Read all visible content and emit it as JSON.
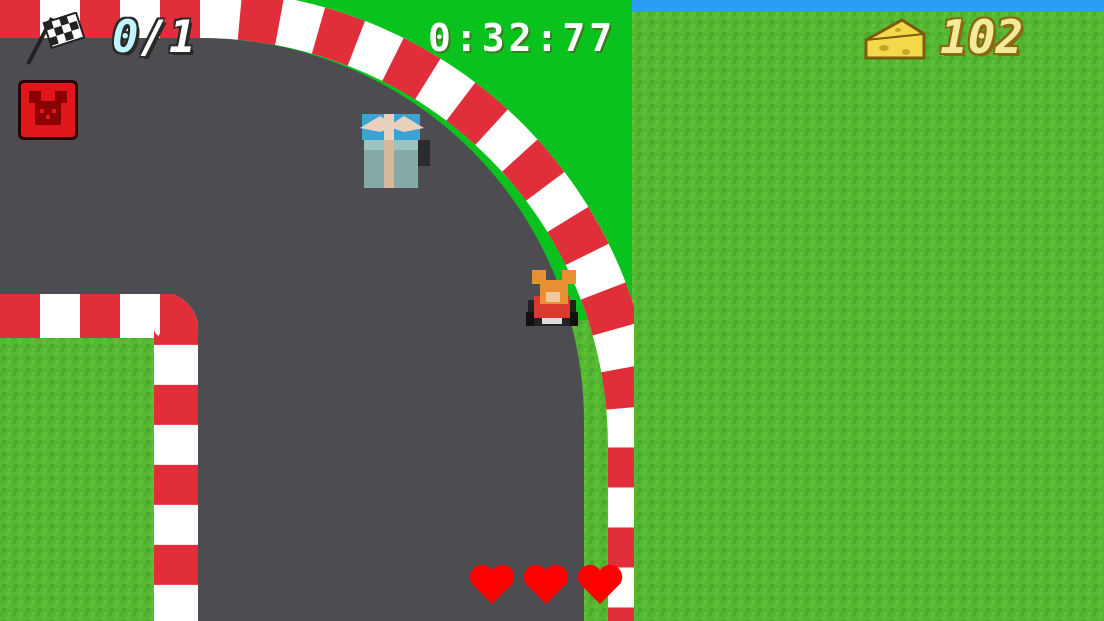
{
  "hud": {
    "lap_current": "0",
    "lap_separator": "/",
    "lap_total": "1",
    "timer": "0:32:77",
    "cheese_count": "102",
    "hearts_remaining": 3
  },
  "icons": {
    "flag": "checkered-flag-icon",
    "powerup": "mouse-face-icon",
    "cheese": "cheese-icon",
    "heart": "heart-icon",
    "gift": "gift-box-icon",
    "kart": "mouse-kart-icon"
  },
  "colors": {
    "grass": "#55b832",
    "inner_grass": "#09c21e",
    "asphalt": "#4d4d51",
    "curb_red": "#e12e3b",
    "curb_white": "#ffffff",
    "sky_strip": "#2a9df4",
    "heart": "#ff0000",
    "powerup_bg": "#e0161a"
  }
}
